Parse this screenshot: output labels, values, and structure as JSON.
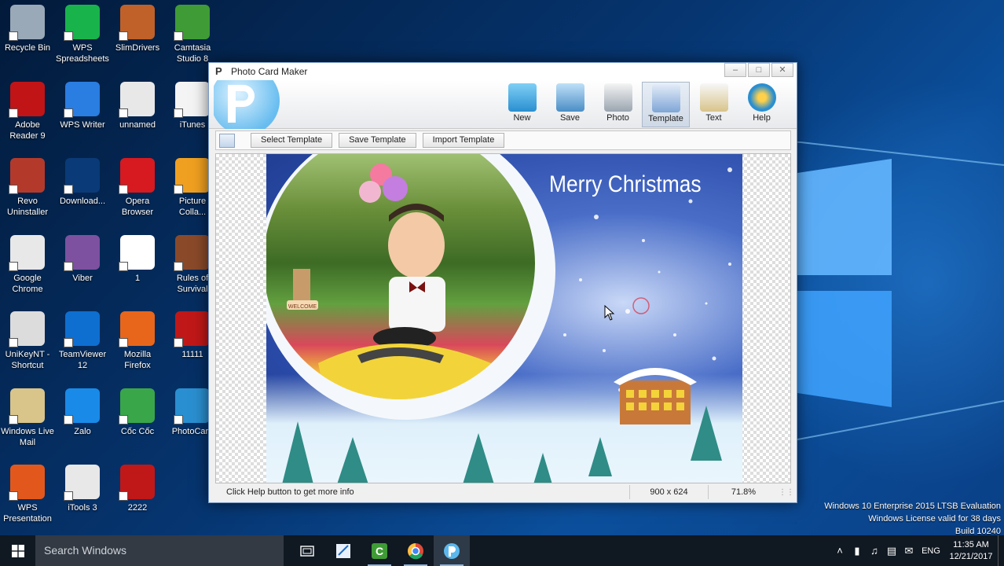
{
  "desktop": {
    "icons": [
      {
        "label": "Recycle Bin",
        "icon": "recycle-bin-icon",
        "color": "#9aa9b8"
      },
      {
        "label": "WPS Spreadsheets",
        "icon": "wps-spreadsheets-icon",
        "color": "#19b34b"
      },
      {
        "label": "SlimDrivers",
        "icon": "slimdrivers-icon",
        "color": "#c0612a"
      },
      {
        "label": "Camtasia Studio 8",
        "icon": "camtasia-icon",
        "color": "#3f9b35"
      },
      {
        "label": "Adobe Reader 9",
        "icon": "adobe-reader-icon",
        "color": "#c01417"
      },
      {
        "label": "WPS Writer",
        "icon": "wps-writer-icon",
        "color": "#2a7de1"
      },
      {
        "label": "unnamed",
        "icon": "chrome-icon",
        "color": "#e8e8e8"
      },
      {
        "label": "iTunes",
        "icon": "itunes-icon",
        "color": "#f4f4f4"
      },
      {
        "label": "Revo Uninstaller",
        "icon": "revo-uninstaller-icon",
        "color": "#b33a2b"
      },
      {
        "label": "Download...",
        "icon": "download-icon",
        "color": "#0a3a78"
      },
      {
        "label": "Opera Browser",
        "icon": "opera-icon",
        "color": "#d61a1f"
      },
      {
        "label": "Picture Colla...",
        "icon": "picture-collage-icon",
        "color": "#f0a020"
      },
      {
        "label": "Google Chrome",
        "icon": "chrome-icon",
        "color": "#e8e8e8"
      },
      {
        "label": "Viber",
        "icon": "viber-icon",
        "color": "#7d51a0"
      },
      {
        "label": "1",
        "icon": "document-icon",
        "color": "#ffffff"
      },
      {
        "label": "Rules of Survival",
        "icon": "rules-of-survival-icon",
        "color": "#8a4a2a"
      },
      {
        "label": "UniKeyNT - Shortcut",
        "icon": "unikey-icon",
        "color": "#dcdcdc"
      },
      {
        "label": "TeamViewer 12",
        "icon": "teamviewer-icon",
        "color": "#0e6fd0"
      },
      {
        "label": "Mozilla Firefox",
        "icon": "firefox-icon",
        "color": "#e8661b"
      },
      {
        "label": "11111",
        "icon": "video-file-icon",
        "color": "#c01818"
      },
      {
        "label": "Windows Live Mail",
        "icon": "live-mail-icon",
        "color": "#d9c48a"
      },
      {
        "label": "Zalo",
        "icon": "zalo-icon",
        "color": "#1a8ae8"
      },
      {
        "label": "Cốc Cốc",
        "icon": "coccoc-icon",
        "color": "#3aa64a"
      },
      {
        "label": "PhotoCard",
        "icon": "photocard-icon",
        "color": "#2a8fd0"
      },
      {
        "label": "WPS Presentation",
        "icon": "wps-presentation-icon",
        "color": "#e2581c"
      },
      {
        "label": "iTools 3",
        "icon": "itools-icon",
        "color": "#e8e8e8"
      },
      {
        "label": "2222",
        "icon": "video-file-icon",
        "color": "#c01818"
      }
    ]
  },
  "window": {
    "title": "Photo Card Maker",
    "toolbar": [
      {
        "label": "New",
        "icon": "folder-icon"
      },
      {
        "label": "Save",
        "icon": "save-icon"
      },
      {
        "label": "Photo",
        "icon": "camera-icon"
      },
      {
        "label": "Template",
        "icon": "template-icon",
        "active": true
      },
      {
        "label": "Text",
        "icon": "pencil-icon"
      },
      {
        "label": "Help",
        "icon": "help-icon"
      }
    ],
    "subbar": {
      "select_template": "Select Template",
      "save_template": "Save Template",
      "import_template": "Import Template"
    },
    "card": {
      "greeting": "Merry Christmas",
      "sign_text": "WELCOME"
    },
    "status": {
      "message": "Click Help button to get more info",
      "dimensions": "900 x 624",
      "zoom": "71.8%"
    }
  },
  "taskbar": {
    "search_placeholder": "Search Windows",
    "language": "ENG",
    "time": "11:35 AM",
    "date": "12/21/2017"
  },
  "watermark": {
    "line1": "Windows 10 Enterprise 2015 LTSB Evaluation",
    "line2": "Windows License valid for 38 days",
    "line3": "Build 10240"
  }
}
